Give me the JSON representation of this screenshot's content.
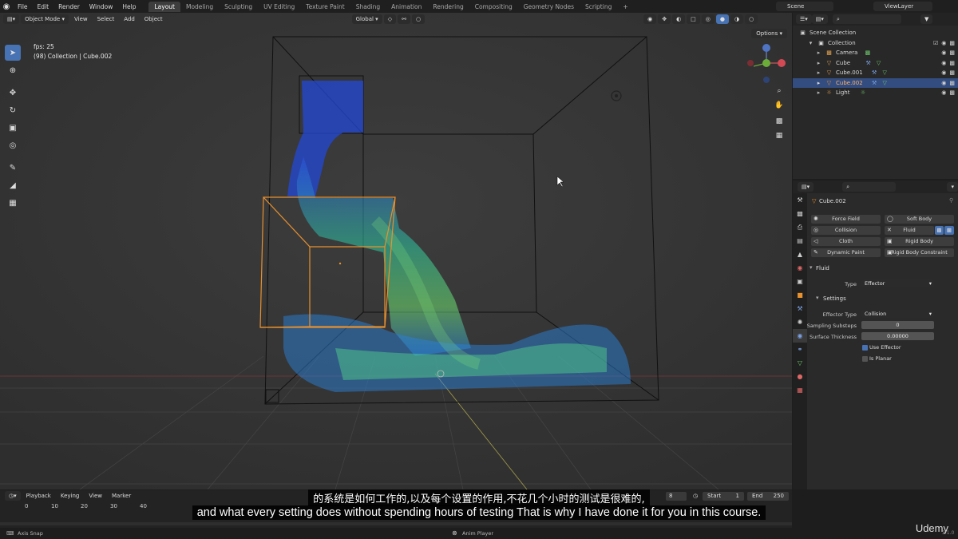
{
  "topbar": {
    "menus": [
      "File",
      "Edit",
      "Render",
      "Window",
      "Help"
    ],
    "workspaces": [
      "Layout",
      "Modeling",
      "Sculpting",
      "UV Editing",
      "Texture Paint",
      "Shading",
      "Animation",
      "Rendering",
      "Compositing",
      "Geometry Nodes",
      "Scripting"
    ],
    "active_workspace": "Layout",
    "add_tab": "+",
    "scene": "Scene",
    "view_layer": "ViewLayer"
  },
  "viewport": {
    "mode": "Object Mode",
    "menus": [
      "View",
      "Select",
      "Add",
      "Object"
    ],
    "transform_orientation": "Global",
    "fps": "fps: 25",
    "collection_info": "(98) Collection | Cube.002",
    "options": "Options"
  },
  "outliner": {
    "root": "Scene Collection",
    "collection": "Collection",
    "items": [
      "Camera",
      "Cube",
      "Cube.001",
      "Cube.002",
      "Light"
    ],
    "selected": "Cube.002"
  },
  "properties": {
    "object_name": "Cube.002",
    "physics_buttons": {
      "force_field": "Force Field",
      "soft_body": "Soft Body",
      "collision": "Collision",
      "fluid": "Fluid",
      "cloth": "Cloth",
      "rigid_body": "Rigid Body",
      "dynamic_paint": "Dynamic Paint",
      "rigid_body_constraint": "Rigid Body Constraint"
    },
    "fluid_panel": "Fluid",
    "type_label": "Type",
    "type_value": "Effector",
    "settings_panel": "Settings",
    "effector_type_label": "Effector Type",
    "effector_type_value": "Collision",
    "sampling_substeps_label": "Sampling Substeps",
    "sampling_substeps_value": "0",
    "surface_thickness_label": "Surface Thickness",
    "surface_thickness_value": "0.00000",
    "use_effector_label": "Use Effector",
    "use_effector": true,
    "is_planar_label": "Is Planar",
    "is_planar": false
  },
  "timeline": {
    "menus": [
      "Playback",
      "Keying",
      "View",
      "Marker"
    ],
    "ticks": [
      "0",
      "10",
      "20",
      "30",
      "40"
    ],
    "start_label": "Start",
    "start_value": "1",
    "end_label": "End",
    "end_value": "250",
    "current_frame_partial": "8"
  },
  "statusbar": {
    "axis_snap": "Axis Snap",
    "anim_player": "Anim Player",
    "version": "3.1.0"
  },
  "subtitles": {
    "chinese": "的系统是如何工作的,以及每个设置的作用,不花几个小时的测试是很难的,",
    "english": "and what every setting does without spending hours of testing  That is why I have done it for you in this course."
  },
  "watermark": "Udemy",
  "colors": {
    "accent_blue": "#4772b3",
    "selection_orange": "#e8912e",
    "viewport_bg": "#3a3a3a"
  }
}
